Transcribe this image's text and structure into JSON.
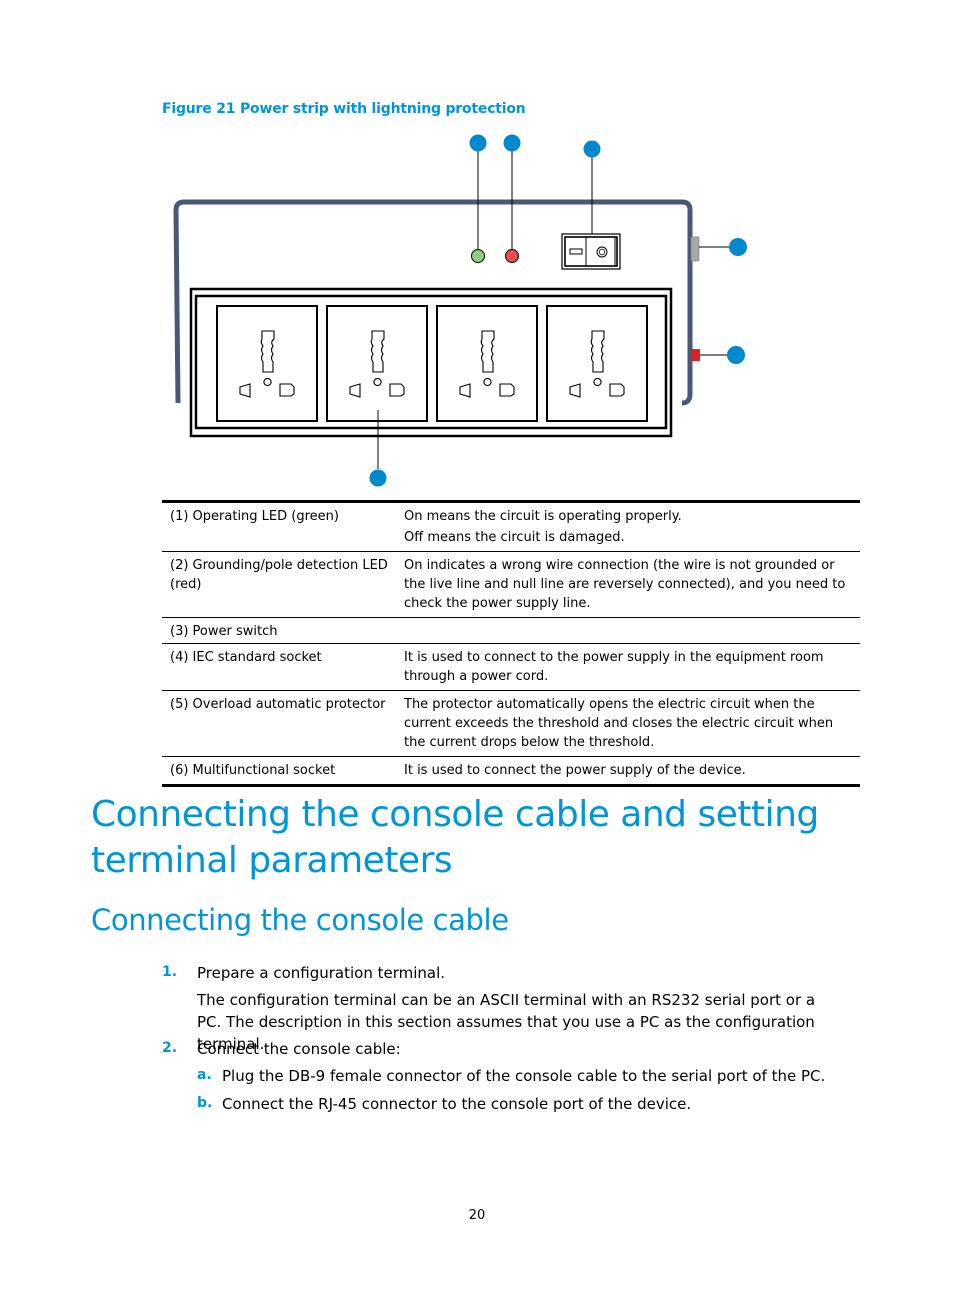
{
  "figure": {
    "title": "Figure 21 Power strip with lightning protection",
    "colors": {
      "callout": "#0088cc",
      "body_outline": "#4a5878",
      "led_green": "#8fd07a",
      "led_red": "#e85050",
      "protector": "#e02020"
    },
    "callouts": [
      {
        "id": 1,
        "label": "Operating LED (green)"
      },
      {
        "id": 2,
        "label": "Grounding/pole detection LED (red)"
      },
      {
        "id": 3,
        "label": "Power switch"
      },
      {
        "id": 4,
        "label": "IEC standard socket"
      },
      {
        "id": 5,
        "label": "Overload automatic protector"
      },
      {
        "id": 6,
        "label": "Multifunctional socket"
      }
    ],
    "socket_count": 4
  },
  "legend_table": {
    "rows": [
      {
        "name": "(1) Operating LED (green)",
        "desc": [
          "On means the circuit is operating properly.",
          "Off means the circuit is damaged."
        ]
      },
      {
        "name": "(2) Grounding/pole detection LED (red)",
        "desc": [
          "On indicates a wrong wire connection (the wire is not grounded or the live line and null line are reversely connected), and you need to check the power supply line."
        ]
      },
      {
        "name": "(3) Power switch",
        "desc": [
          ""
        ]
      },
      {
        "name": "(4) IEC standard socket",
        "desc": [
          "It is used to connect to the power supply in the equipment room through a power cord."
        ]
      },
      {
        "name": "(5) Overload automatic protector",
        "desc": [
          "The protector automatically opens the electric circuit when the current exceeds the threshold and closes the electric circuit when the current drops below the threshold."
        ]
      },
      {
        "name": "(6) Multifunctional socket",
        "desc": [
          "It is used to connect the power supply of the device."
        ]
      }
    ]
  },
  "heading1": "Connecting the console cable and setting terminal parameters",
  "heading2": "Connecting the console cable",
  "steps": [
    {
      "num": "1.",
      "text": "Prepare a configuration terminal.",
      "detail": "The configuration terminal can be an ASCII terminal with an RS232 serial port or a PC. The description in this section assumes that you use a PC as the configuration terminal."
    },
    {
      "num": "2.",
      "text": "Connect the console cable:",
      "substeps": [
        {
          "num": "a.",
          "text": "Plug the DB-9 female connector of the console cable to the serial port of the PC."
        },
        {
          "num": "b.",
          "text": "Connect the RJ-45 connector to the console port of the device."
        }
      ]
    }
  ],
  "page_number": "20"
}
